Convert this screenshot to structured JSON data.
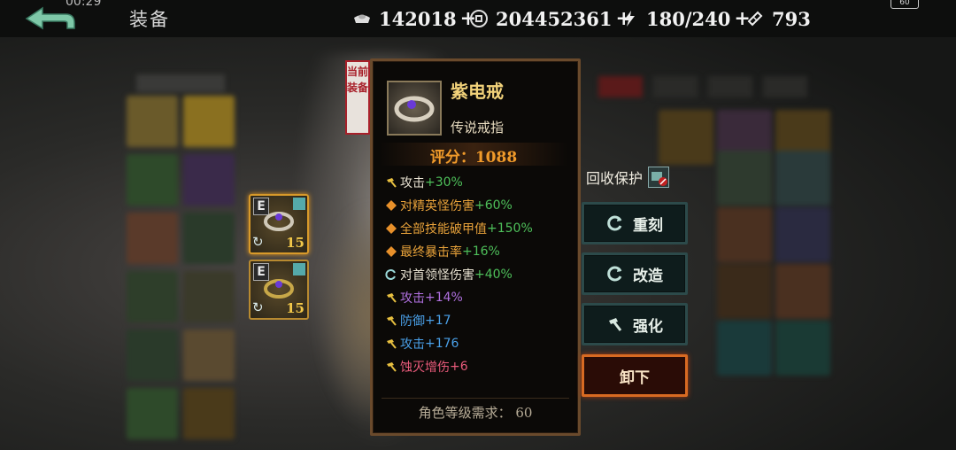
{
  "status": {
    "time": "00:29",
    "battery": "60"
  },
  "header": {
    "title": "装备"
  },
  "resources": [
    {
      "icon": "silver-ingot-icon",
      "value": "142018",
      "plus": "+"
    },
    {
      "icon": "coin-icon",
      "value": "204452361",
      "plus": "+"
    },
    {
      "icon": "lightning-icon",
      "value": "180/240",
      "plus": "+"
    },
    {
      "icon": "ticket-icon",
      "value": "793"
    }
  ],
  "equipped": [
    {
      "badge": "E",
      "level": "15",
      "selected": true
    },
    {
      "badge": "E",
      "level": "15",
      "selected": false
    }
  ],
  "current_tag": "当前装备",
  "item": {
    "name": "紫电戒",
    "type": "传说戒指",
    "score_label": "评分：",
    "score": "1088",
    "stats": [
      {
        "icon": "hammer-icon",
        "name": "攻击",
        "value": "+30%",
        "color": "#e8e2d2"
      },
      {
        "icon": "diamond-icon",
        "name": "对精英怪伤害",
        "value": "+60%",
        "color": "#e8a23a"
      },
      {
        "icon": "diamond-icon",
        "name": "全部技能破甲值",
        "value": "+150%",
        "color": "#e8a23a"
      },
      {
        "icon": "diamond-icon",
        "name": "最终暴击率",
        "value": "+16%",
        "color": "#e8a23a"
      },
      {
        "icon": "refresh-icon",
        "name": "对首领怪伤害",
        "value": "+40%",
        "color": "#e8e2d2"
      },
      {
        "icon": "hammer-icon",
        "name": "攻击",
        "value": "+14%",
        "color": "#b070e0"
      },
      {
        "icon": "hammer-icon",
        "name": "防御",
        "value": "+17",
        "color": "#4aa0e8"
      },
      {
        "icon": "hammer-icon",
        "name": "攻击",
        "value": "+176",
        "color": "#4aa0e8"
      },
      {
        "icon": "hammer-icon",
        "name": "蚀灭增伤",
        "value": "+6",
        "color": "#e85a7a"
      }
    ],
    "requirement": "角色等级需求：  60"
  },
  "recycle_label": "回收保护",
  "buttons": {
    "reforge": "重刻",
    "modify": "改造",
    "enhance": "强化",
    "unequip": "卸下"
  }
}
